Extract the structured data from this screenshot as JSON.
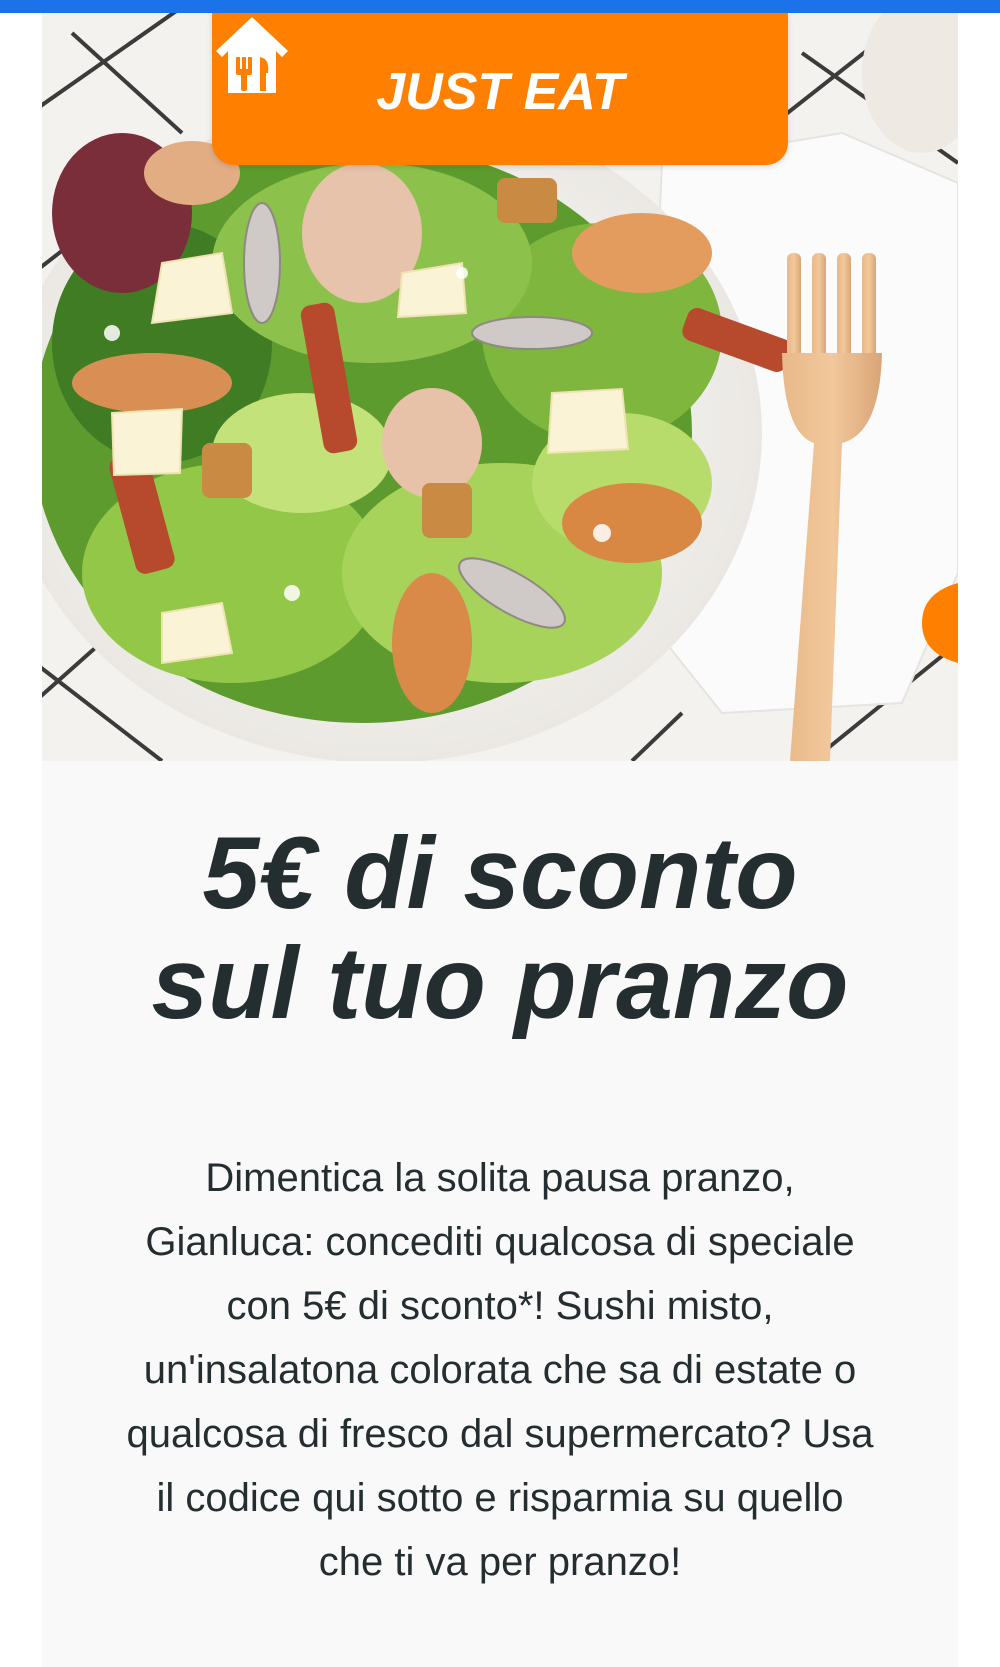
{
  "brand": {
    "name": "JUST EAT",
    "logo_icon": "house-cutlery-icon",
    "color": "#ff8000"
  },
  "hero": {
    "image": "caesar-salad-photo",
    "props": [
      "salad-bowl",
      "wooden-fork"
    ]
  },
  "headline": {
    "line1": "5€ di sconto",
    "line2": "sul tuo pranzo"
  },
  "body": {
    "text": "Dimentica la solita pausa pranzo, Gianluca: concediti qualcosa di speciale con 5€ di sconto*! Sushi misto, un'insalatona colorata che sa di estate o qualcosa di fresco dal supermercato? Usa il codice qui sotto e risparmia su quello che ti va per pranzo!"
  },
  "colors": {
    "top_bar": "#1a73e8",
    "text": "#242e30",
    "card_background": "#f9f9f9"
  }
}
